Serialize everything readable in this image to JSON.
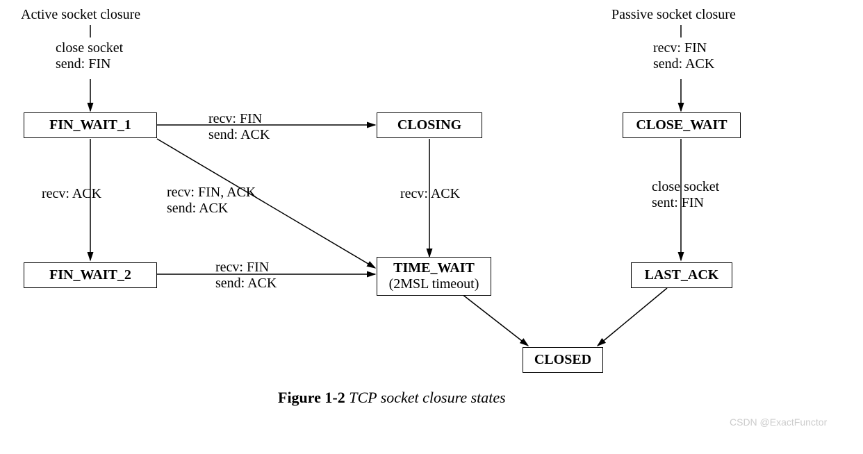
{
  "headers": {
    "active": "Active socket closure",
    "passive": "Passive socket closure"
  },
  "states": {
    "fin_wait_1": "FIN_WAIT_1",
    "fin_wait_2": "FIN_WAIT_2",
    "closing": "CLOSING",
    "time_wait_title": "TIME_WAIT",
    "time_wait_sub": "(2MSL timeout)",
    "close_wait": "CLOSE_WAIT",
    "last_ack": "LAST_ACK",
    "closed": "CLOSED"
  },
  "transitions": {
    "active_entry_l1": "close socket",
    "active_entry_l2": "send: FIN",
    "passive_entry_l1": "recv: FIN",
    "passive_entry_l2": "send: ACK",
    "fw1_to_fw2": "recv: ACK",
    "fw1_to_closing_l1": "recv: FIN",
    "fw1_to_closing_l2": "send: ACK",
    "fw1_to_tw_l1": "recv: FIN, ACK",
    "fw1_to_tw_l2": "send: ACK",
    "closing_to_tw": "recv: ACK",
    "fw2_to_tw_l1": "recv: FIN",
    "fw2_to_tw_l2": "send: ACK",
    "cw_to_la_l1": "close socket",
    "cw_to_la_l2": "sent: FIN"
  },
  "caption": {
    "figno": "Figure 1-2",
    "title": "TCP socket closure states"
  },
  "watermark": "CSDN @ExactFunctor"
}
